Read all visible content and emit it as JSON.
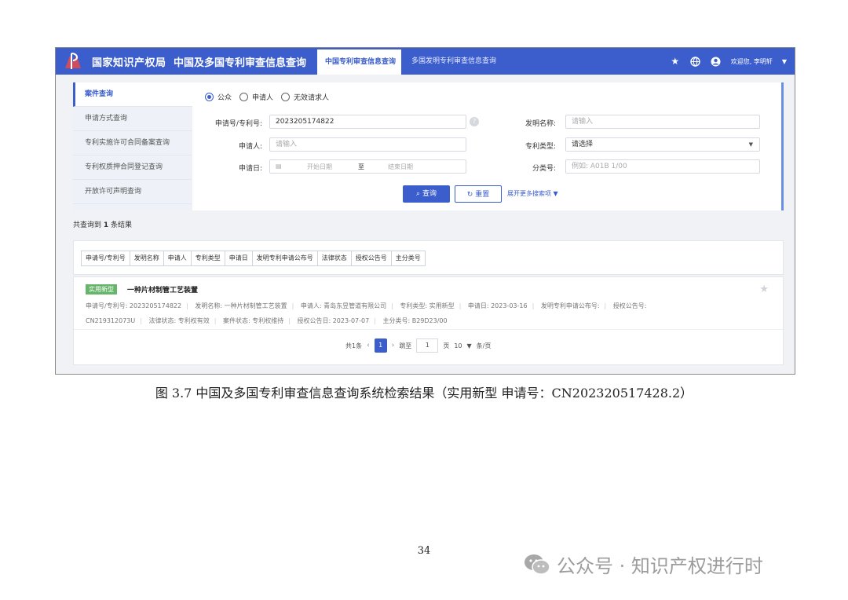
{
  "app": {
    "agency": "国家知识产权局",
    "system": "中国及多国专利审查信息查询",
    "tabs": [
      "中国专利审查信息查询",
      "多国发明专利审查信息查询"
    ],
    "welcome": "欢迎您, 李明轩"
  },
  "sidebar": {
    "items": [
      "案件查询",
      "申请方式查询",
      "专利实施许可合同备案查询",
      "专利权质押合同登记查询",
      "开放许可声明查询"
    ]
  },
  "search": {
    "radios": [
      "公众",
      "申请人",
      "无效请求人"
    ],
    "selected_radio": "公众",
    "app_no_label": "申请号/专利号:",
    "app_no_value": "2023205174822",
    "invention_name_label": "发明名称:",
    "invention_name_placeholder": "请输入",
    "applicant_label": "申请人:",
    "applicant_placeholder": "请输入",
    "patent_type_label": "专利类型:",
    "patent_type_value": "请选择",
    "date_label": "申请日:",
    "date_start_placeholder": "开始日期",
    "date_sep": "至",
    "date_end_placeholder": "结束日期",
    "class_label": "分类号:",
    "class_placeholder": "例如: A01B 1/00",
    "search_button": "查询",
    "reset_button": "重置",
    "expand_link": "展开更多搜索项"
  },
  "results": {
    "summary_prefix": "共查询到",
    "summary_count": "1",
    "summary_suffix": "条结果",
    "sort_tags": [
      "申请号/专利号",
      "发明名称",
      "申请人",
      "专利类型",
      "申请日",
      "发明专利申请公布号",
      "法律状态",
      "授权公告号",
      "主分类号"
    ],
    "items": [
      {
        "badge": "实用新型",
        "title": "一种片材制管工艺装置",
        "row1": [
          "申请号/专利号: 2023205174822",
          "发明名称: 一种片材制管工艺装置",
          "申请人: 青岛东昱管道有限公司",
          "专利类型: 实用新型",
          "申请日: 2023-03-16",
          "发明专利申请公布号:",
          "授权公告号:"
        ],
        "row2": [
          "CN219312073U",
          "法律状态: 专利权有效",
          "案件状态: 专利权维持",
          "授权公告日: 2023-07-07",
          "主分类号: B29D23/00"
        ]
      }
    ]
  },
  "pagination": {
    "total": "共1条",
    "current": "1",
    "goto_label": "跳至",
    "goto_value": "1",
    "page_unit": "页",
    "page_size": "10",
    "page_size_unit": "条/页"
  },
  "caption": "图 3.7  中国及多国专利审查信息查询系统检索结果（实用新型  申请号：CN202320517428.2）",
  "page_number": "34",
  "watermark": "公众号 · 知识产权进行时",
  "colors": {
    "primary": "#3b5ecc",
    "badge": "#67b56b"
  }
}
